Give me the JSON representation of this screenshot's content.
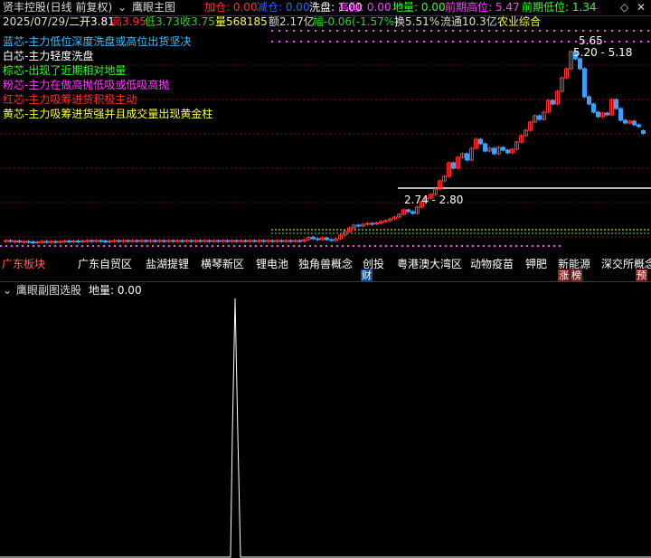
{
  "header": {
    "stock_title": "贤丰控股(日线 前复权)",
    "dropdown_icon": "chevron-down-circle-icon",
    "indicator_name": "鹰眼主图",
    "indicators": [
      {
        "label": "加仓: 0.00",
        "color": "#ff3030"
      },
      {
        "label": "减仓: 0.00",
        "color": "#3060ff"
      },
      {
        "label": "洗盘: 1.00",
        "color": "#ffffff"
      },
      {
        "label": "高抛: 0.00",
        "color": "#ff40ff"
      },
      {
        "label": "地量: 0.00",
        "color": "#30ff30"
      },
      {
        "label": "前期高位: 5.47",
        "color": "#ff40ff"
      },
      {
        "label": "前期低位: 1.34",
        "color": "#30ff30"
      }
    ],
    "right_icons": [
      "diamond-icon",
      "close-icon"
    ]
  },
  "quote": [
    {
      "text": "2025/07/29/二",
      "color": "#dddddd"
    },
    {
      "text": "开3.81",
      "color": "#ffffff"
    },
    {
      "text": "高3.95",
      "color": "#ff3030"
    },
    {
      "text": "低3.73",
      "color": "#30d030"
    },
    {
      "text": "收3.75",
      "color": "#30d030"
    },
    {
      "text": "量568185",
      "color": "#ffff40"
    },
    {
      "text": "额2.17亿",
      "color": "#dddddd"
    },
    {
      "text": "幅-0.06(-1.57%)",
      "color": "#30d030"
    },
    {
      "text": "换5.51%",
      "color": "#dddddd"
    },
    {
      "text": "流通10.3亿",
      "color": "#dddddd"
    },
    {
      "text": "农业综合",
      "color": "#ffff40"
    }
  ],
  "legend": [
    {
      "text": "蓝芯-主力低位深度洗盘或高位出货坚决",
      "color": "#40c0ff"
    },
    {
      "text": "白芯-主力轻度洗盘",
      "color": "#ffffff"
    },
    {
      "text": "棕芯-出现了近期相对地量",
      "color": "#30ff30"
    },
    {
      "text": "粉芯-主力在做高抛低吸或低吸高抛",
      "color": "#ff40ff"
    },
    {
      "text": "红芯-主力吸筹进货积极主动",
      "color": "#ff3030"
    },
    {
      "text": "黄芯-主力吸筹进货强并且成交量出现黄金柱",
      "color": "#ffff40"
    }
  ],
  "price_labels": {
    "high": "5.65",
    "range_upper": "5.20 - 5.18",
    "range_lower": "2.74 - 2.80"
  },
  "concepts": [
    "广东板块",
    "广东自贸区",
    "盐湖提锂",
    "横琴新区",
    "锂电池",
    "独角兽概念",
    "创投",
    "粤港澳大湾区",
    "动物疫苗",
    "钾肥",
    "新能源",
    "深交所概念"
  ],
  "event_badges": {
    "cai": "财",
    "zhangting": "涨",
    "bang": "榜",
    "yu": "预"
  },
  "sub_panel": {
    "name": "鹰眼副图选股",
    "value_label": "地量: 0.00"
  },
  "chart_data": {
    "type": "candlestick",
    "price_range_visible": [
      1.2,
      5.9
    ],
    "candles": [
      {
        "o": 1.36,
        "c": 1.38
      },
      {
        "o": 1.38,
        "c": 1.36
      },
      {
        "o": 1.35,
        "c": 1.37
      },
      {
        "o": 1.37,
        "c": 1.35
      },
      {
        "o": 1.35,
        "c": 1.36
      },
      {
        "o": 1.36,
        "c": 1.35
      },
      {
        "o": 1.35,
        "c": 1.34
      },
      {
        "o": 1.34,
        "c": 1.35
      },
      {
        "o": 1.35,
        "c": 1.36
      },
      {
        "o": 1.36,
        "c": 1.35
      },
      {
        "o": 1.35,
        "c": 1.36
      },
      {
        "o": 1.36,
        "c": 1.35
      },
      {
        "o": 1.35,
        "c": 1.36
      },
      {
        "o": 1.36,
        "c": 1.37
      },
      {
        "o": 1.37,
        "c": 1.36
      },
      {
        "o": 1.36,
        "c": 1.37
      },
      {
        "o": 1.37,
        "c": 1.36
      },
      {
        "o": 1.36,
        "c": 1.37
      },
      {
        "o": 1.37,
        "c": 1.38
      },
      {
        "o": 1.38,
        "c": 1.37
      },
      {
        "o": 1.37,
        "c": 1.38
      },
      {
        "o": 1.38,
        "c": 1.37
      },
      {
        "o": 1.37,
        "c": 1.36
      },
      {
        "o": 1.36,
        "c": 1.37
      },
      {
        "o": 1.37,
        "c": 1.38
      },
      {
        "o": 1.38,
        "c": 1.37
      },
      {
        "o": 1.37,
        "c": 1.38
      },
      {
        "o": 1.38,
        "c": 1.37
      },
      {
        "o": 1.37,
        "c": 1.38
      },
      {
        "o": 1.38,
        "c": 1.37
      },
      {
        "o": 1.37,
        "c": 1.38
      },
      {
        "o": 1.38,
        "c": 1.37
      },
      {
        "o": 1.37,
        "c": 1.38
      },
      {
        "o": 1.38,
        "c": 1.37
      },
      {
        "o": 1.37,
        "c": 1.38
      },
      {
        "o": 1.38,
        "c": 1.37
      },
      {
        "o": 1.37,
        "c": 1.38
      },
      {
        "o": 1.38,
        "c": 1.37
      },
      {
        "o": 1.37,
        "c": 1.38
      },
      {
        "o": 1.38,
        "c": 1.37
      },
      {
        "o": 1.37,
        "c": 1.38
      },
      {
        "o": 1.38,
        "c": 1.37
      },
      {
        "o": 1.37,
        "c": 1.38
      },
      {
        "o": 1.38,
        "c": 1.37
      },
      {
        "o": 1.37,
        "c": 1.38
      },
      {
        "o": 1.38,
        "c": 1.37
      },
      {
        "o": 1.37,
        "c": 1.38
      },
      {
        "o": 1.38,
        "c": 1.37
      },
      {
        "o": 1.37,
        "c": 1.38
      },
      {
        "o": 1.38,
        "c": 1.37
      },
      {
        "o": 1.37,
        "c": 1.38
      },
      {
        "o": 1.38,
        "c": 1.37
      },
      {
        "o": 1.37,
        "c": 1.38
      },
      {
        "o": 1.38,
        "c": 1.37
      },
      {
        "o": 1.37,
        "c": 1.38
      },
      {
        "o": 1.38,
        "c": 1.37
      },
      {
        "o": 1.37,
        "c": 1.38
      },
      {
        "o": 1.38,
        "c": 1.37
      },
      {
        "o": 1.37,
        "c": 1.38
      },
      {
        "o": 1.38,
        "c": 1.37
      },
      {
        "o": 1.37,
        "c": 1.38
      },
      {
        "o": 1.38,
        "c": 1.37
      },
      {
        "o": 1.37,
        "c": 1.38
      },
      {
        "o": 1.38,
        "c": 1.37
      },
      {
        "o": 1.37,
        "c": 1.38
      },
      {
        "o": 1.38,
        "c": 1.37
      },
      {
        "o": 1.37,
        "c": 1.4
      },
      {
        "o": 1.4,
        "c": 1.45
      },
      {
        "o": 1.45,
        "c": 1.42
      },
      {
        "o": 1.42,
        "c": 1.4
      },
      {
        "o": 1.4,
        "c": 1.44
      },
      {
        "o": 1.44,
        "c": 1.4
      },
      {
        "o": 1.4,
        "c": 1.38
      },
      {
        "o": 1.38,
        "c": 1.42
      },
      {
        "o": 1.42,
        "c": 1.5
      },
      {
        "o": 1.5,
        "c": 1.58
      },
      {
        "o": 1.58,
        "c": 1.66
      },
      {
        "o": 1.66,
        "c": 1.72
      },
      {
        "o": 1.72,
        "c": 1.7
      },
      {
        "o": 1.7,
        "c": 1.74
      },
      {
        "o": 1.74,
        "c": 1.76
      },
      {
        "o": 1.76,
        "c": 1.75
      },
      {
        "o": 1.75,
        "c": 1.77
      },
      {
        "o": 1.77,
        "c": 1.8
      },
      {
        "o": 1.8,
        "c": 1.82
      },
      {
        "o": 1.82,
        "c": 1.86
      },
      {
        "o": 1.86,
        "c": 1.9
      },
      {
        "o": 1.9,
        "c": 1.96
      },
      {
        "o": 1.96,
        "c": 2.06
      },
      {
        "o": 2.06,
        "c": 2.02
      },
      {
        "o": 2.02,
        "c": 1.98
      },
      {
        "o": 1.98,
        "c": 2.12
      },
      {
        "o": 2.12,
        "c": 2.24
      },
      {
        "o": 2.24,
        "c": 2.32
      },
      {
        "o": 2.32,
        "c": 2.4
      },
      {
        "o": 2.4,
        "c": 2.52
      },
      {
        "o": 2.52,
        "c": 2.7
      },
      {
        "o": 2.7,
        "c": 2.8
      },
      {
        "o": 2.8,
        "c": 3.1
      },
      {
        "o": 3.1,
        "c": 2.98
      },
      {
        "o": 2.98,
        "c": 3.22
      },
      {
        "o": 3.22,
        "c": 3.3
      },
      {
        "o": 3.3,
        "c": 3.16
      },
      {
        "o": 3.16,
        "c": 3.42
      },
      {
        "o": 3.42,
        "c": 3.62
      },
      {
        "o": 3.62,
        "c": 3.52
      },
      {
        "o": 3.52,
        "c": 3.36
      },
      {
        "o": 3.36,
        "c": 3.42
      },
      {
        "o": 3.42,
        "c": 3.3
      },
      {
        "o": 3.3,
        "c": 3.44
      },
      {
        "o": 3.44,
        "c": 3.38
      },
      {
        "o": 3.38,
        "c": 3.32
      },
      {
        "o": 3.32,
        "c": 3.4
      },
      {
        "o": 3.4,
        "c": 3.56
      },
      {
        "o": 3.56,
        "c": 3.7
      },
      {
        "o": 3.7,
        "c": 3.82
      },
      {
        "o": 3.82,
        "c": 4.0
      },
      {
        "o": 4.0,
        "c": 4.14
      },
      {
        "o": 4.14,
        "c": 4.06
      },
      {
        "o": 4.06,
        "c": 4.22
      },
      {
        "o": 4.22,
        "c": 4.48
      },
      {
        "o": 4.48,
        "c": 4.4
      },
      {
        "o": 4.4,
        "c": 4.68
      },
      {
        "o": 4.68,
        "c": 4.98
      },
      {
        "o": 4.98,
        "c": 5.18
      },
      {
        "o": 5.18,
        "c": 5.56
      },
      {
        "o": 5.56,
        "c": 5.4
      },
      {
        "o": 5.4,
        "c": 5.18
      },
      {
        "o": 5.18,
        "c": 4.56
      },
      {
        "o": 4.56,
        "c": 4.4
      },
      {
        "o": 4.4,
        "c": 4.22
      },
      {
        "o": 4.22,
        "c": 4.12
      },
      {
        "o": 4.12,
        "c": 4.2
      },
      {
        "o": 4.2,
        "c": 4.16
      },
      {
        "o": 4.16,
        "c": 4.5
      },
      {
        "o": 4.5,
        "c": 4.3
      },
      {
        "o": 4.3,
        "c": 4.04
      },
      {
        "o": 4.04,
        "c": 3.98
      },
      {
        "o": 3.98,
        "c": 4.02
      },
      {
        "o": 4.02,
        "c": 3.94
      },
      {
        "o": 3.94,
        "c": 3.9
      },
      {
        "o": 3.81,
        "c": 3.75
      }
    ]
  },
  "colors": {
    "up": "#ff3232",
    "down": "#3aa0ff",
    "grid": "#7a1515",
    "magenta": "#ff40ff",
    "sub_line": "#ffffff"
  }
}
